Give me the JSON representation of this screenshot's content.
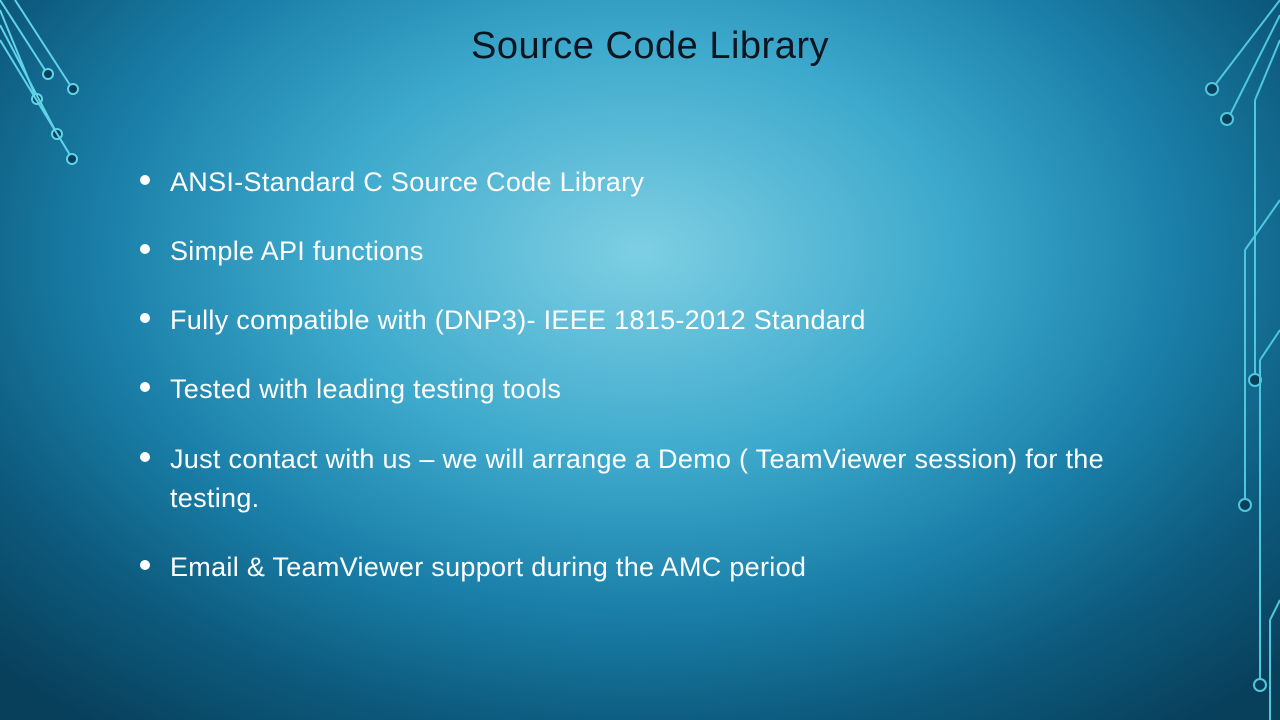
{
  "title": "Source Code Library",
  "bullets": [
    "ANSI-Standard C Source Code Library",
    "Simple API functions",
    "Fully compatible with (DNP3)- IEEE 1815-2012 Standard",
    "Tested with leading testing tools",
    "Just contact with us – we will arrange a Demo ( TeamViewer session) for the testing.",
    "Email & TeamViewer support during the AMC period"
  ]
}
